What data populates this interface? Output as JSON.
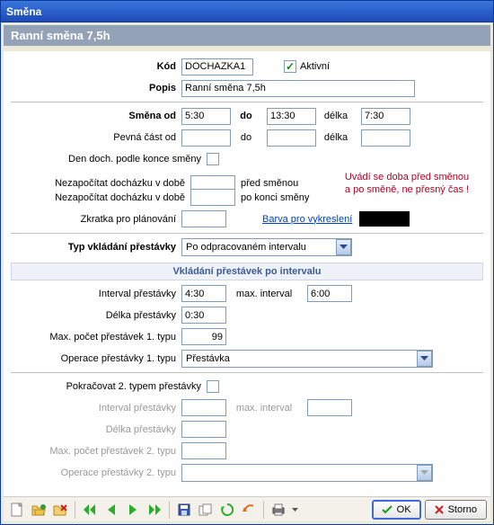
{
  "title": "Směna",
  "subtitle": "Ranní směna 7,5h",
  "labels": {
    "kod": "Kód",
    "popis": "Popis",
    "aktivni": "Aktivní",
    "smena_od": "Směna od",
    "do": "do",
    "delka": "délka",
    "pevna_cast_od": "Pevná část od",
    "den_doch": "Den doch. podle konce směny",
    "nezapocitat_pred": "Nezapočítat docházku v době",
    "pred_smenou": "před směnou",
    "nezapocitat_po": "Nezapočítat docházku v době",
    "po_konci": "po konci směny",
    "zkratka": "Zkratka pro plánování",
    "barva": "Barva pro vykreslení",
    "typ_vkladani": "Typ vkládání přestávky",
    "section_interval": "Vkládání přestávek po intervalu",
    "interval_prest": "Interval přestávky",
    "max_interval": "max. interval",
    "delka_prest": "Délka přestávky",
    "max_pocet_1": "Max. počet přestávek 1. typu",
    "operace_1": "Operace přestávky 1. typu",
    "pokracovat_2": "Pokračovat 2. typem přestávky",
    "interval_prest2": "Interval přestávky",
    "max_interval2": "max. interval",
    "delka_prest2": "Délka přestávky",
    "max_pocet_2": "Max. počet přestávek 2. typu",
    "operace_2": "Operace přestávky 2. typu"
  },
  "values": {
    "kod": "DOCHAZKA1",
    "popis": "Ranní směna 7,5h",
    "aktivni": true,
    "smena_od": "5:30",
    "smena_do": "13:30",
    "smena_delka": "7:30",
    "pevna_od": "",
    "pevna_do": "",
    "pevna_delka": "",
    "den_doch": false,
    "nezap_pred": "",
    "nezap_po": "",
    "zkratka": "",
    "typ_vkladani_sel": "Po odpracovaném intervalu",
    "interval_prest": "4:30",
    "max_interval": "6:00",
    "delka_prest": "0:30",
    "max_pocet_1": "99",
    "operace_1_sel": "Přestávka",
    "pokracovat_2": false,
    "interval_prest2": "",
    "max_interval2": "",
    "delka_prest2": "",
    "max_pocet_2": "",
    "operace_2_sel": ""
  },
  "warn": {
    "line1": "Uvádí se doba před směnou",
    "line2": "a po směně, ne přesný čas !"
  },
  "buttons": {
    "ok": "OK",
    "storno": "Storno"
  },
  "colors": {
    "barva": "#000000"
  }
}
